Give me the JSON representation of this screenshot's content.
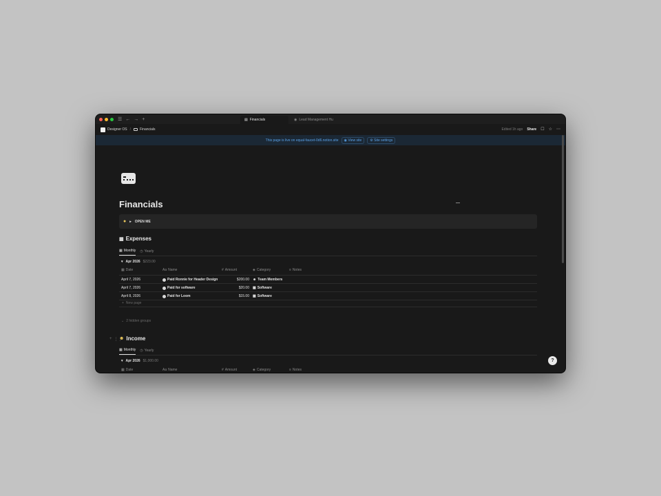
{
  "window": {
    "tabs": [
      {
        "label": "Financials",
        "active": true
      },
      {
        "label": "Lead Management Hu",
        "active": false
      }
    ]
  },
  "breadcrumb": {
    "workspace": "Designer OS",
    "page": "Financials"
  },
  "pagebar": {
    "edited": "Edited 1h ago",
    "share": "Share"
  },
  "livebar": {
    "text": "This page is live on equal-faucet-0d6.notion.site",
    "view_site": "View site",
    "site_settings": "Site settings"
  },
  "page": {
    "title": "Financials",
    "callout": "OPEN ME"
  },
  "expenses": {
    "heading": "Expenses",
    "views": [
      "Monthly",
      "Yearly"
    ],
    "group": {
      "label": "Apr 2026",
      "total": "$223.00"
    },
    "columns": [
      "Date",
      "Name",
      "Amount",
      "Category",
      "Notes"
    ],
    "rows": [
      {
        "date": "April 7, 2026",
        "name": "Paid Ronnie for Header Design",
        "amount": "$200.00",
        "category": "Team Members"
      },
      {
        "date": "April 7, 2026",
        "name": "Paid for software",
        "amount": "$20.00",
        "category": "Software"
      },
      {
        "date": "April 8, 2026",
        "name": "Paid for Loom",
        "amount": "$15.00",
        "category": "Software"
      }
    ],
    "new_page": "New page",
    "hidden_groups": "2 hidden groups"
  },
  "income": {
    "heading": "Income",
    "views": [
      "Monthly",
      "Yearly"
    ],
    "group": {
      "label": "Apr 2026",
      "total": "$1,000.00"
    },
    "columns": [
      "Date",
      "Name",
      "Amount",
      "Category",
      "Notes"
    ]
  },
  "help": "?"
}
